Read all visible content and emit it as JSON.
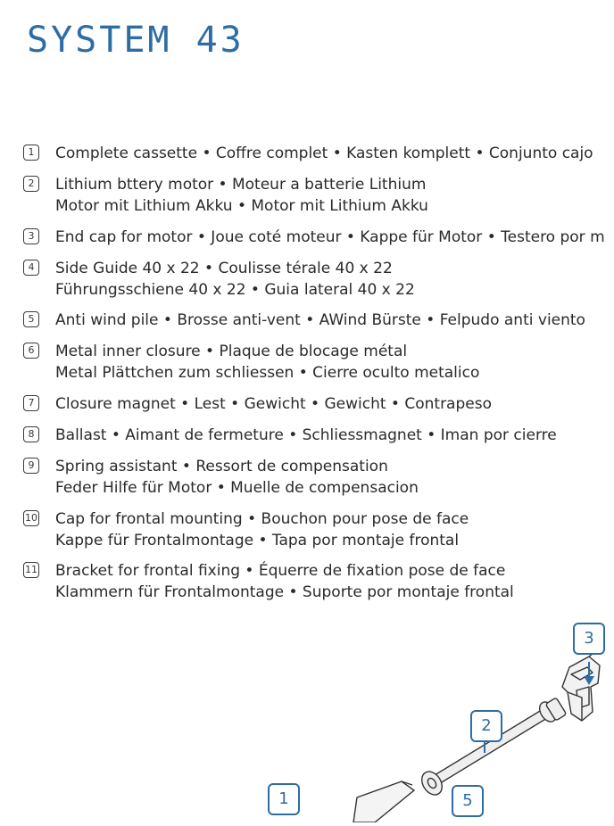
{
  "page": {
    "title": "SYSTEM 43"
  },
  "parts": [
    {
      "num": "1",
      "line1": "Complete cassette • Coffre complet • Kasten komplett • Conjunto cajo",
      "line2": ""
    },
    {
      "num": "2",
      "line1": "Lithium bttery motor • Moteur a batterie Lithium",
      "line2": "Motor mit Lithium Akku • Motor mit Lithium Akku"
    },
    {
      "num": "3",
      "line1": "End cap for motor • Joue coté moteur • Kappe für Motor • Testero por m",
      "line2": ""
    },
    {
      "num": "4",
      "line1": "Side Guide 40 x 22 • Coulisse térale 40 x 22",
      "line2": "Führungsschiene 40 x 22 • Guia lateral 40 x 22"
    },
    {
      "num": "5",
      "line1": "Anti wind pile • Brosse anti-vent • AWind Bürste • Felpudo anti viento",
      "line2": ""
    },
    {
      "num": "6",
      "line1": "Metal inner closure • Plaque de blocage métal",
      "line2": "Metal Plättchen zum schliessen • Cierre oculto metalico"
    },
    {
      "num": "7",
      "line1": "Closure magnet • Lest • Gewicht • Gewicht • Contrapeso",
      "line2": ""
    },
    {
      "num": "8",
      "line1": "Ballast • Aimant de fermeture • Schliessmagnet • Iman por cierre",
      "line2": ""
    },
    {
      "num": "9",
      "line1": "Spring assistant • Ressort de compensation",
      "line2": "Feder Hilfe für Motor • Muelle de compensacion"
    },
    {
      "num": "10",
      "line1": "Cap for frontal mounting • Bouchon pour pose de face",
      "line2": "Kappe für Frontalmontage • Tapa por montaje frontal"
    },
    {
      "num": "11",
      "line1": "Bracket for frontal fixing • Équerre de fixation pose de face",
      "line2": "Klammern für Frontalmontage • Suporte por montaje frontal"
    }
  ],
  "diagram": {
    "callouts": [
      "3",
      "2",
      "1",
      "5"
    ],
    "accent": "#2e6da4"
  }
}
